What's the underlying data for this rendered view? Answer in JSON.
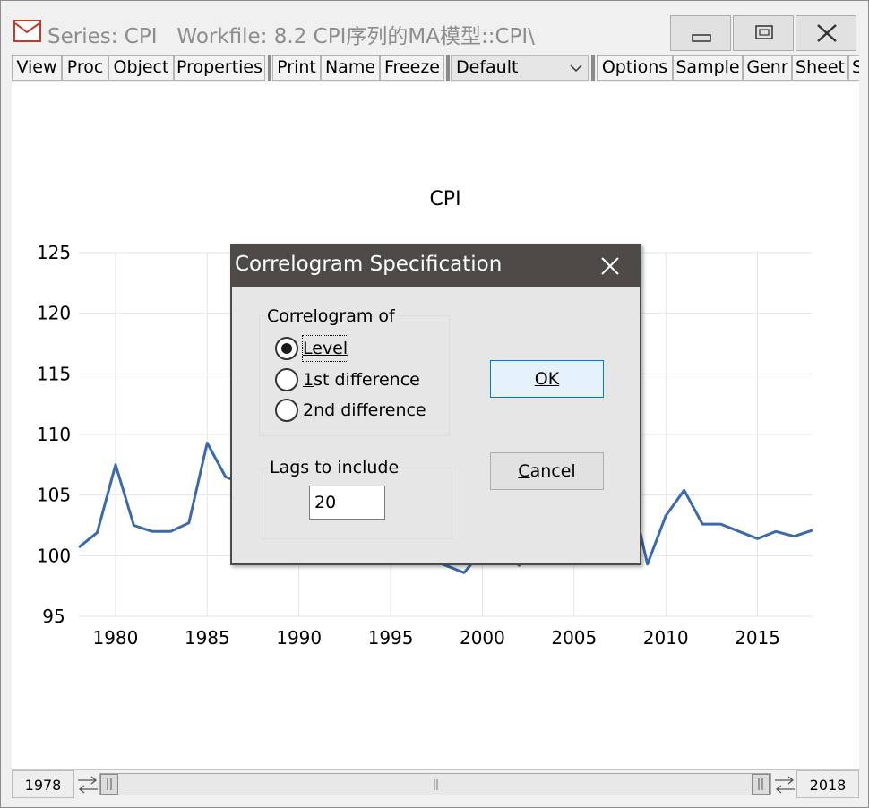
{
  "window": {
    "title": "Series: CPI   Workfile: 8.2 CPI序列的MA模型::CPI\\",
    "minimize_label": "minimize",
    "maximize_label": "maximize",
    "close_label": "close"
  },
  "toolbar": {
    "group1": [
      "View",
      "Proc",
      "Object",
      "Properties"
    ],
    "group2": [
      "Print",
      "Name",
      "Freeze"
    ],
    "view_select_value": "Default",
    "group3": [
      "Options",
      "Sample",
      "Genr",
      "Sheet",
      "S"
    ]
  },
  "chart_data": {
    "type": "line",
    "title": "CPI",
    "xlabel": "",
    "ylabel": "",
    "ylim": [
      95,
      125
    ],
    "xlim": [
      1978,
      2018
    ],
    "yticks": [
      "95",
      "100",
      "105",
      "110",
      "115",
      "120",
      "125"
    ],
    "xticks": [
      "1980",
      "1985",
      "1990",
      "1995",
      "2000",
      "2005",
      "2010",
      "2015"
    ],
    "grid": true,
    "series": [
      {
        "name": "CPI",
        "color": "#3b6aac",
        "x": [
          1978,
          1979,
          1980,
          1981,
          1982,
          1983,
          1984,
          1985,
          1986,
          1998,
          1999,
          2000,
          2001,
          2002,
          2003,
          2008,
          2009,
          2010,
          2011,
          2012,
          2013,
          2014,
          2015,
          2016,
          2017,
          2018
        ],
        "values": [
          100.7,
          101.9,
          107.5,
          102.5,
          102.0,
          102.0,
          102.7,
          109.3,
          106.5,
          99.2,
          98.6,
          100.4,
          100.7,
          99.2,
          101.2,
          105.9,
          99.3,
          103.3,
          105.4,
          102.6,
          102.6,
          102.0,
          101.4,
          102.0,
          101.6,
          102.1
        ]
      }
    ]
  },
  "sample_bar": {
    "start_year": "1978",
    "end_year": "2018"
  },
  "dialog": {
    "title": "Correlogram Specification",
    "group_label": "Correlogram of",
    "options": [
      "Level",
      "1st difference",
      "2nd difference"
    ],
    "selected": "Level",
    "lags_label": "Lags to include",
    "lags_value": "20",
    "ok_label": "OK",
    "cancel_label": "Cancel"
  }
}
